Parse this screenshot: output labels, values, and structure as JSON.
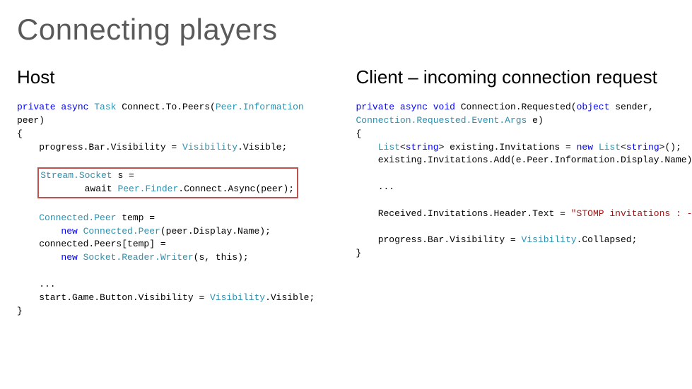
{
  "title": "Connecting players",
  "left": {
    "heading": "Host",
    "sig_pre": "private async ",
    "sig_task": "Task",
    "sig_mid": " Connect.To.Peers(",
    "sig_param_type": "Peer.Information",
    "sig_tail": "\npeer)\n{\n    progress.Bar.Visibility = ",
    "vis_type": "Visibility",
    "vis_visible": ".Visible;",
    "box_l1a": "Stream.Socket",
    "box_l1b": " s =",
    "box_l2a": "        await ",
    "box_l2b": "Peer.Finder",
    "box_l2c": ".Connect.Async(peer);",
    "after_l1a": "    ",
    "after_l1b": "Connected.Peer",
    "after_l1c": " temp =",
    "after_l2a": "        new ",
    "after_l2b": "Connected.Peer",
    "after_l2c": "(peer.Display.Name);",
    "after_l3": "    connected.Peers[temp] =",
    "after_l4a": "        new ",
    "after_l4b": "Socket.Reader.Writer",
    "after_l4c": "(s, this);",
    "dots": "    ...",
    "start_a": "    start.Game.Button.Visibility = ",
    "start_b": "Visibility",
    "start_c": ".Visible;",
    "close": "}"
  },
  "right": {
    "heading": "Client – incoming connection request",
    "sig_pre": "private async void",
    "sig_name": " Connection.Requested(",
    "sig_obj": "object",
    "sig_sender": " sender,",
    "sig_l2a": "Connection.Requested.Event.Args",
    "sig_l2b": " e)",
    "open": "{",
    "list_a": "    ",
    "list_b": "List",
    "list_c": "<",
    "list_d": "string",
    "list_e": "> existing.Invitations = ",
    "list_f": "new ",
    "list_g": "List",
    "list_h": "<",
    "list_i": "string",
    "list_j": ">();",
    "add": "    existing.Invitations.Add(e.Peer.Information.Display.Name);",
    "dots": "    ...",
    "recv_a": "    Received.Invitations.Header.Text = ",
    "recv_str": "\"STOMP invitations : -)\"",
    "recv_c": ";",
    "prog_a": "    progress.Bar.Visibility = ",
    "prog_b": "Visibility",
    "prog_c": ".Collapsed;",
    "close": "}"
  }
}
